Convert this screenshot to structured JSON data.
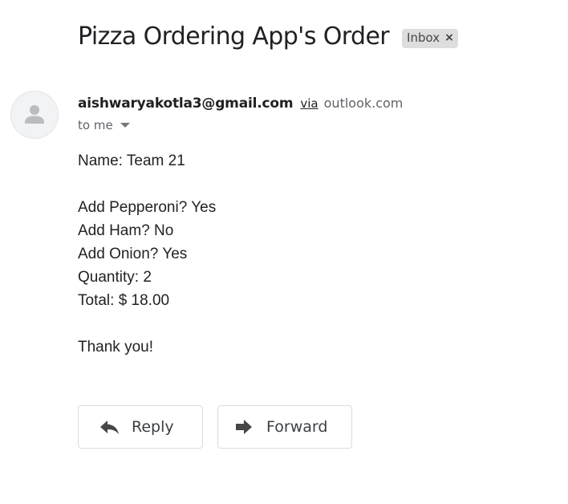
{
  "email": {
    "subject": "Pizza Ordering App's Order",
    "label": {
      "text": "Inbox",
      "close_glyph": "×"
    },
    "sender": {
      "email": "aishwaryakotla3@gmail.com",
      "via_text": "via",
      "via_domain": "outlook.com",
      "avatar_icon": "person-icon"
    },
    "recipient": "to me",
    "body": {
      "name_line": "Name: Team 21",
      "pepperoni_line": "Add Pepperoni? Yes",
      "ham_line": "Add Ham? No",
      "onion_line": "Add Onion? Yes",
      "quantity_line": "Quantity: 2",
      "total_line": "Total: $ 18.00",
      "closing_line": "Thank you!"
    }
  },
  "actions": {
    "reply_label": "Reply",
    "reply_icon": "reply-icon",
    "forward_label": "Forward",
    "forward_icon": "forward-icon"
  }
}
